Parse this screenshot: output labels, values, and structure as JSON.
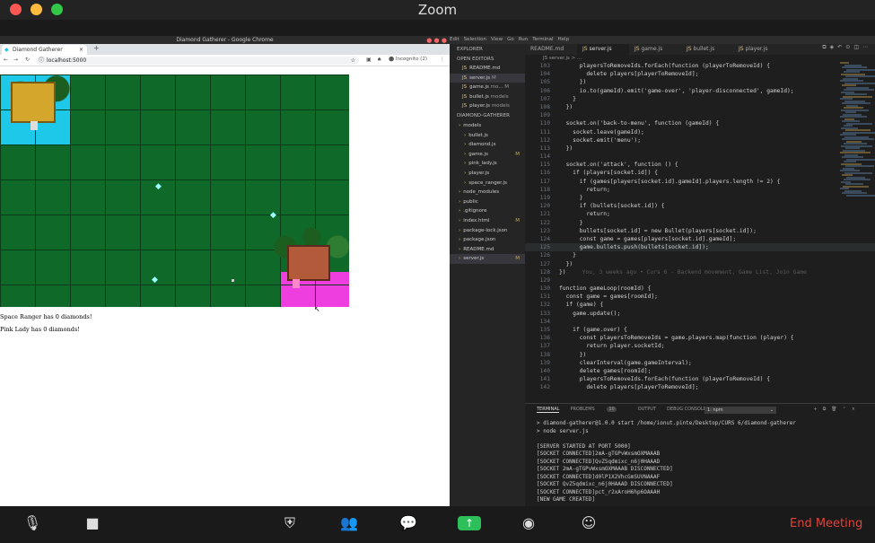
{
  "zoom": {
    "title": "Zoom",
    "end_meeting": "End Meeting"
  },
  "chrome": {
    "window_title": "Diamond Gatherer - Google Chrome",
    "tab_title": "Diamond Gatherer",
    "url": "localhost:5000",
    "incognito": "Incognito (2)"
  },
  "game": {
    "status_lines": [
      "Space Ranger has 0 diamonds!",
      "Pink Lady has 0 diamonds!"
    ]
  },
  "vscode": {
    "menu": [
      "Edit",
      "Selection",
      "View",
      "Go",
      "Run",
      "Terminal",
      "Help"
    ],
    "tabs": [
      "README.md",
      "server.js",
      "game.js",
      "bullet.js",
      "player.js"
    ],
    "breadcrumb": "JS server.js > ...",
    "explorer_title": "EXPLORER",
    "open_editors_title": "OPEN EDITORS",
    "open_editors": [
      {
        "name": "README.md",
        "status": ""
      },
      {
        "name": "server.js",
        "status": "M"
      },
      {
        "name": "game.js",
        "status": "mo... M"
      },
      {
        "name": "bullet.js",
        "status": "models"
      },
      {
        "name": "player.js",
        "status": "models"
      }
    ],
    "project_title": "DIAMOND-GATHERER",
    "project_files": [
      {
        "name": "models",
        "status": ""
      },
      {
        "name": "bullet.js",
        "status": ""
      },
      {
        "name": "diamond.js",
        "status": ""
      },
      {
        "name": "game.js",
        "status": "M"
      },
      {
        "name": "pink_lady.js",
        "status": ""
      },
      {
        "name": "player.js",
        "status": ""
      },
      {
        "name": "space_ranger.js",
        "status": ""
      },
      {
        "name": "node_modules",
        "status": ""
      },
      {
        "name": "public",
        "status": ""
      },
      {
        "name": ".gitignore",
        "status": ""
      },
      {
        "name": "index.html",
        "status": "M"
      },
      {
        "name": "package-lock.json",
        "status": ""
      },
      {
        "name": "package.json",
        "status": ""
      },
      {
        "name": "README.md",
        "status": ""
      },
      {
        "name": "server.js",
        "status": "M"
      }
    ],
    "code_lines": [
      {
        "n": "103",
        "t": "      playersToRemoveIds.forEach(function (playerToRemoveId) {"
      },
      {
        "n": "104",
        "t": "        delete players[playerToRemoveId];"
      },
      {
        "n": "105",
        "t": "      })"
      },
      {
        "n": "106",
        "t": "      io.to(gameId).emit('game-over', 'player-disconnected', gameId);"
      },
      {
        "n": "107",
        "t": "    }"
      },
      {
        "n": "108",
        "t": "  })"
      },
      {
        "n": "109",
        "t": ""
      },
      {
        "n": "110",
        "t": "  socket.on('back-to-menu', function (gameId) {"
      },
      {
        "n": "111",
        "t": "    socket.leave(gameId);"
      },
      {
        "n": "112",
        "t": "    socket.emit('menu');"
      },
      {
        "n": "113",
        "t": "  })"
      },
      {
        "n": "114",
        "t": ""
      },
      {
        "n": "115",
        "t": "  socket.on('attack', function () {"
      },
      {
        "n": "116",
        "t": "    if (players[socket.id]) {"
      },
      {
        "n": "117",
        "t": "      if (games[players[socket.id].gameId].players.length != 2) {"
      },
      {
        "n": "118",
        "t": "        return;"
      },
      {
        "n": "119",
        "t": "      }"
      },
      {
        "n": "120",
        "t": "      if (bullets[socket.id]) {"
      },
      {
        "n": "121",
        "t": "        return;"
      },
      {
        "n": "122",
        "t": "      }"
      },
      {
        "n": "123",
        "t": "      bullets[socket.id] = new Bullet(players[socket.id]);"
      },
      {
        "n": "124",
        "t": "      const game = games[players[socket.id].gameId];"
      },
      {
        "n": "125",
        "t": "      game.bullets.push(bullets[socket.id]);"
      },
      {
        "n": "126",
        "t": "    }"
      },
      {
        "n": "127",
        "t": "  })"
      },
      {
        "n": "128",
        "t": "})"
      },
      {
        "n": "129",
        "t": ""
      },
      {
        "n": "130",
        "t": "function gameLoop(roomId) {"
      },
      {
        "n": "131",
        "t": "  const game = games[roomId];"
      },
      {
        "n": "132",
        "t": "  if (game) {"
      },
      {
        "n": "133",
        "t": "    game.update();"
      },
      {
        "n": "134",
        "t": ""
      },
      {
        "n": "135",
        "t": "    if (game.over) {"
      },
      {
        "n": "136",
        "t": "      const playersToRemoveIds = game.players.map(function (player) {"
      },
      {
        "n": "137",
        "t": "        return player.socketId;"
      },
      {
        "n": "138",
        "t": "      })"
      },
      {
        "n": "139",
        "t": "      clearInterval(game.gameInterval);"
      },
      {
        "n": "140",
        "t": "      delete games[roomId];"
      },
      {
        "n": "141",
        "t": "      playersToRemoveIds.forEach(function (playerToRemoveId) {"
      },
      {
        "n": "142",
        "t": "        delete players[playerToRemoveId];"
      }
    ],
    "blame_text": "You, 3 weeks ago • Curs 6 - Backend movement, Game List, Join Game",
    "panel_tabs": [
      "TERMINAL",
      "PROBLEMS",
      "OUTPUT",
      "DEBUG CONSOLE"
    ],
    "problems_count": "10",
    "terminal_select": "1: npm",
    "terminal_lines": [
      "> diamond-gatherer@1.0.0 start /home/ionut.pinte/Desktop/CURS 6/diamond-gatherer",
      "> node server.js",
      "",
      "[SERVER STARTED AT PORT 5000]",
      "[SOCKET CONNECTED]2mA-gTGPvWxsmOXMAAAB",
      "[SOCKET CONNECTED]QvZ5qdmixc_n6j0HAAAD",
      "[SOCKET 2mA-gTGPvWxsmOXMAAAB DISCONNECTED]",
      "[SOCKET CONNECTED]d0lP1X2VhcGmSUVNAAAF",
      "[SOCKET QvZ5qdmixc_n6j0HAAAD DISCONNECTED]",
      "[SOCKET CONNECTED]pct_r2xAroH6hp6OAAAH",
      "[NEW GAME CREATED]"
    ]
  },
  "colors": {
    "end_meeting": "#e0433a",
    "grass": "#0f6a2a",
    "water": "#1ec8e8",
    "pink": "#ee3ee0"
  }
}
